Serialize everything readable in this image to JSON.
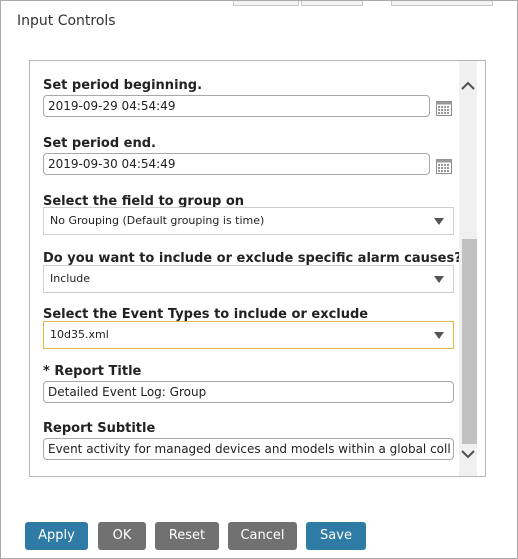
{
  "dialog": {
    "title": "Input Controls"
  },
  "fields": {
    "period_begin": {
      "label": "Set period beginning.",
      "value": "2019-09-29 04:54:49"
    },
    "period_end": {
      "label": "Set period end.",
      "value": "2019-09-30 04:54:49"
    },
    "group_field": {
      "label": "Select the field to group on",
      "selected": "No Grouping (Default grouping is time)"
    },
    "alarm_causes": {
      "label": "Do you want to include or exclude specific alarm causes?",
      "selected": "Include"
    },
    "event_types": {
      "label": "Select the Event Types to include or exclude",
      "selected": "10d35.xml"
    },
    "report_title": {
      "label": "* Report Title",
      "value": "Detailed Event Log: Group"
    },
    "report_subtitle": {
      "label": "Report Subtitle",
      "value": "Event activity for managed devices and models within a global coll"
    }
  },
  "buttons": {
    "apply": "Apply",
    "ok": "OK",
    "reset": "Reset",
    "cancel": "Cancel",
    "save": "Save"
  },
  "colors": {
    "primary_button": "#2e7ba5",
    "secondary_button": "#717171",
    "active_select_border": "#e0b84a"
  },
  "icons": {
    "calendar": "calendar-icon",
    "dropdown": "chevron-down-icon",
    "scroll_up": "chevron-up-icon",
    "scroll_down": "chevron-down-icon"
  }
}
